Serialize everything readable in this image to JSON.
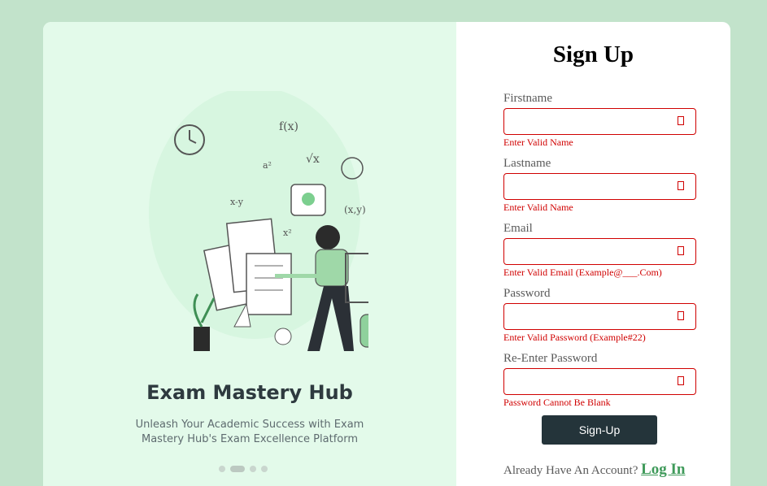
{
  "brand": {
    "title": "Exam Mastery Hub",
    "subtitle_line1": "Unleash Your Academic Success with Exam",
    "subtitle_line2": "Mastery Hub's Exam Excellence Platform"
  },
  "carousel": {
    "slides": 4,
    "active_index": 1
  },
  "form": {
    "title": "Sign Up",
    "fields": [
      {
        "label": "Firstname",
        "value": "",
        "error": "Enter Valid Name"
      },
      {
        "label": "Lastname",
        "value": "",
        "error": "Enter Valid Name"
      },
      {
        "label": "Email",
        "value": "",
        "error": "Enter Valid Email (Example@___.Com)"
      },
      {
        "label": "Password",
        "value": "",
        "error": "Enter Valid Password (Example#22)"
      },
      {
        "label": "Re-Enter Password",
        "value": "",
        "error": "Password Cannot Be Blank"
      }
    ],
    "submit_label": "Sign-Up",
    "account_prompt": "Already Have An Account?",
    "login_link": "Log In"
  },
  "colors": {
    "page_bg": "#c2e3cb",
    "panel_bg": "#e3faea",
    "error": "#d00000",
    "button_bg": "#24343a",
    "link": "#3f9a5a"
  }
}
